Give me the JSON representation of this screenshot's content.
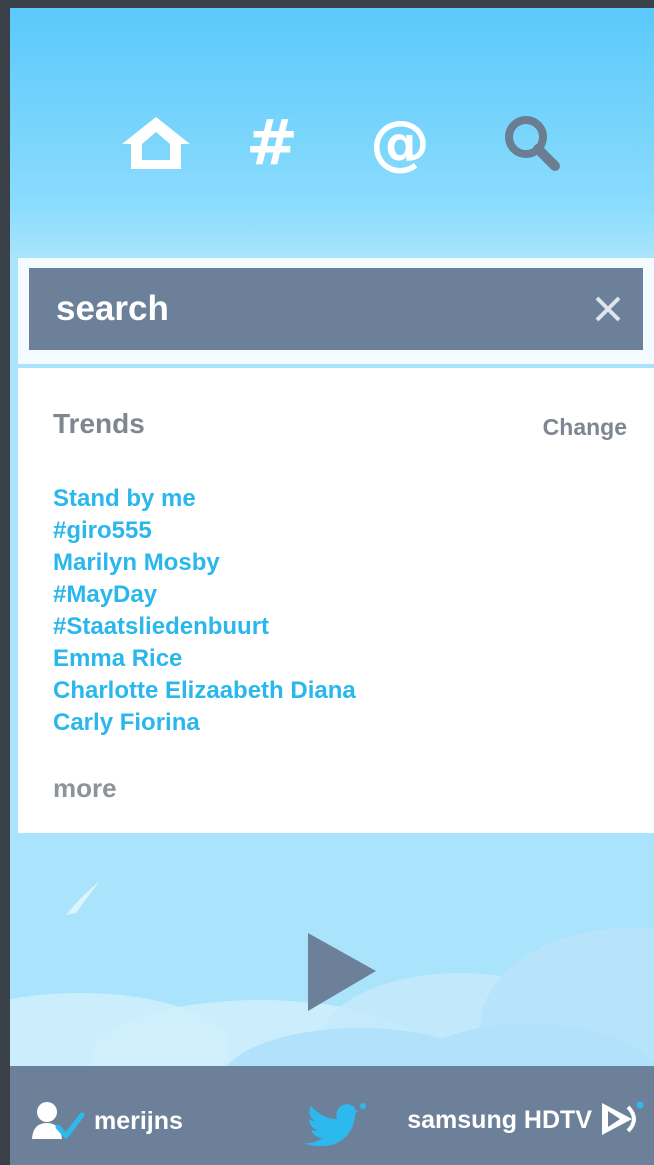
{
  "nav": {
    "icons": [
      "home-icon",
      "hashtag-icon",
      "mention-icon",
      "search-icon"
    ],
    "hash_glyph": "#",
    "at_glyph": "@"
  },
  "search": {
    "placeholder": "search",
    "clear_glyph": "✕",
    "clear_icon": "close-icon"
  },
  "trends": {
    "title": "Trends",
    "change_label": "Change",
    "items": [
      "Stand by me",
      "#giro555",
      "Marilyn Mosby",
      "#MayDay",
      "#Staatsliedenbuurt",
      "Emma Rice",
      "Charlotte Elizaabeth Diana",
      "Carly Fiorina"
    ],
    "more_label": "more"
  },
  "player": {
    "play_icon": "play-icon"
  },
  "footer": {
    "username": "merijns",
    "device_name": "samsung HDTV",
    "user_icon": "user-check-icon",
    "logo_icon": "twitter-bird-icon",
    "device_icon": "cast-icon"
  },
  "colors": {
    "sky_top": "#5ac9fb",
    "sky_bottom": "#a9e4fc",
    "bar_slate": "#6c8199",
    "trend_link": "#29b7ec",
    "muted_text": "#7e8791"
  }
}
